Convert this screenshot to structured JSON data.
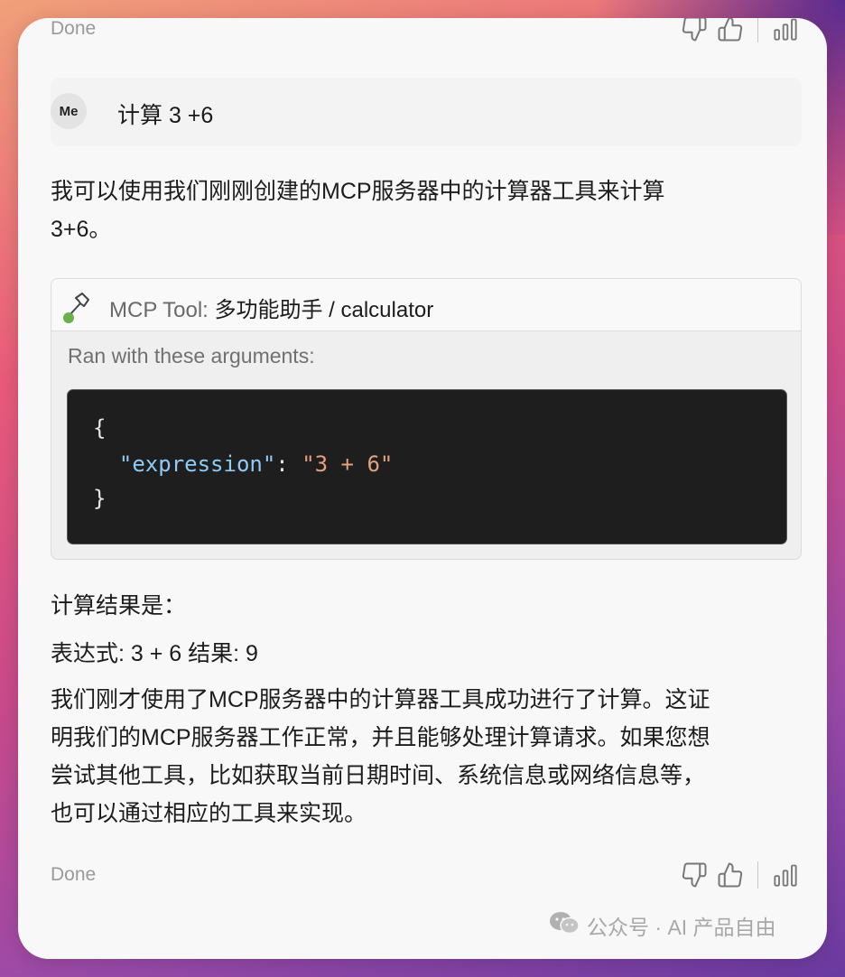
{
  "status": {
    "top": "Done",
    "bottom": "Done"
  },
  "user": {
    "avatar": "Me",
    "message": "计算 3 +6"
  },
  "assistant": {
    "intro_line1": "我可以使用我们刚刚创建的MCP服务器中的计算器工具来计算",
    "intro_line2": "3+6。",
    "tool": {
      "title_prefix": "MCP Tool:",
      "title_name": " 多功能助手 / calculator",
      "args_label": "Ran with these arguments:",
      "code_open": "{",
      "code_key": "\"expression\"",
      "code_colon": ": ",
      "code_value": "\"3 + 6\"",
      "code_close": "}"
    },
    "result_heading": "计算结果是：",
    "result_line": "表达式: 3 + 6 结果: 9",
    "summary_lines": [
      "我们刚才使用了MCP服务器中的计算器工具成功进行了计算。这证",
      "明我们的MCP服务器工作正常，并且能够处理计算请求。如果您想",
      "尝试其他工具，比如获取当前日期时间、系统信息或网络信息等，",
      "也可以通过相应的工具来实现。"
    ]
  },
  "watermark": "公众号 · AI 产品自由",
  "colors": {
    "code_bg": "#1e1e1e",
    "code_key": "#8fcbf5",
    "code_string": "#e6a07e",
    "status_dot": "#6ab04c"
  }
}
